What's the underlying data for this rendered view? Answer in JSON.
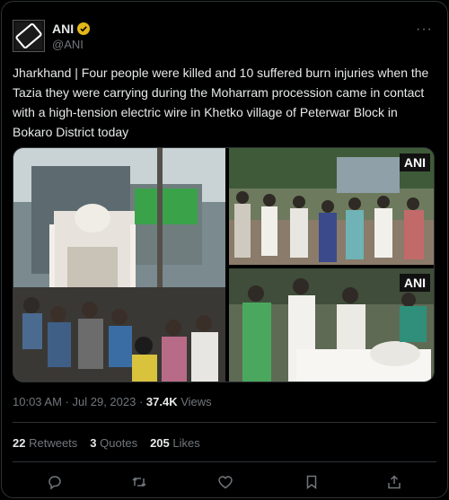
{
  "author": {
    "display_name": "ANI",
    "handle": "@ANI",
    "avatar_logo_text": "ANI",
    "verified": true
  },
  "more_icon": "more-horizontal-icon",
  "tweet": {
    "text": "Jharkhand | Four people were killed and 10 suffered burn injuries when the Tazia they were carrying during the Moharram procession came in contact with a high-tension electric wire in Khetko village of Peterwar Block in Bokaro District today"
  },
  "media": {
    "watermarks": [
      "ANI",
      "ANI"
    ]
  },
  "meta": {
    "time": "10:03 AM",
    "separator1": " · ",
    "date": "Jul 29, 2023",
    "separator2": " · ",
    "views_count": "37.4K",
    "views_label": " Views"
  },
  "stats": {
    "retweets_count": "22",
    "retweets_label": "Retweets",
    "quotes_count": "3",
    "quotes_label": "Quotes",
    "likes_count": "205",
    "likes_label": "Likes"
  },
  "actions": [
    "reply-icon",
    "retweet-icon",
    "like-icon",
    "bookmark-icon",
    "share-icon"
  ],
  "colors": {
    "background": "#000000",
    "text": "#e7e9ea",
    "muted": "#71767b",
    "border": "#2f3336",
    "verified_gold": "#e2b719"
  }
}
